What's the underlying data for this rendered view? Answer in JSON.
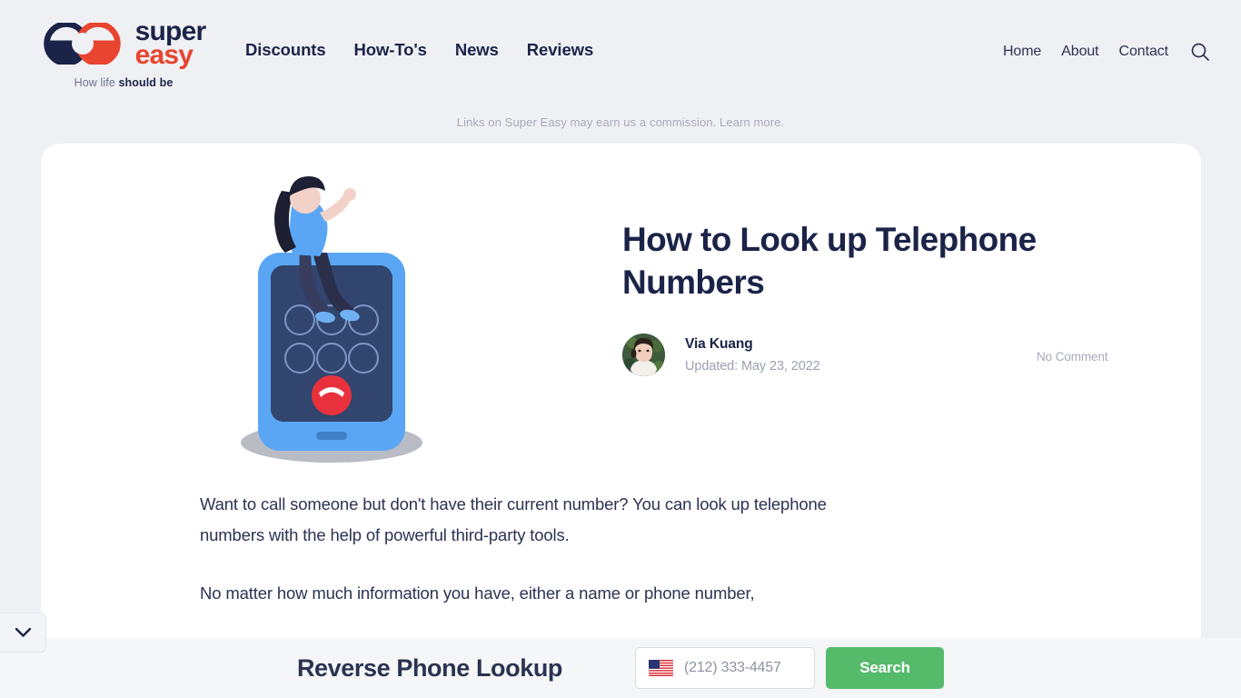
{
  "brand": {
    "name_line1": "super",
    "name_line2": "easy",
    "tagline_prefix": "How life ",
    "tagline_strong": "should be",
    "colors": {
      "navy": "#1b2348",
      "red": "#e8442f"
    }
  },
  "header": {
    "main_nav": [
      {
        "label": "Discounts"
      },
      {
        "label": "How-To's"
      },
      {
        "label": "News"
      },
      {
        "label": "Reviews"
      }
    ],
    "util_nav": [
      {
        "label": "Home"
      },
      {
        "label": "About"
      },
      {
        "label": "Contact"
      }
    ],
    "search_icon": "search-icon"
  },
  "disclaimer": {
    "text": "Links on Super Easy may earn us a commission.",
    "link_label": "Learn more."
  },
  "article": {
    "title": "How to Look up Telephone Numbers",
    "author": "Via Kuang",
    "updated": "Updated: May 23, 2022",
    "comments": "No Comment",
    "paragraphs": [
      "Want to call someone but don't have their current number? You can look up telephone numbers with the help of powerful third-party tools.",
      "No matter how much information you have, either a name or phone number,"
    ]
  },
  "illustration": {
    "name": "woman-sitting-on-smartphone-illustration",
    "phone_color": "#5aa6f5",
    "screen_color": "#2c3b63",
    "end_call_color": "#e8313d",
    "keypad_circles": 6
  },
  "side_toggle": {
    "icon": "chevron-down-icon"
  },
  "lookup_bar": {
    "title": "Reverse Phone Lookup",
    "country_flag": "us-flag-icon",
    "phone_value": "",
    "phone_placeholder": "(212) 333-4457",
    "search_label": "Search",
    "search_color": "#55bb6b"
  }
}
